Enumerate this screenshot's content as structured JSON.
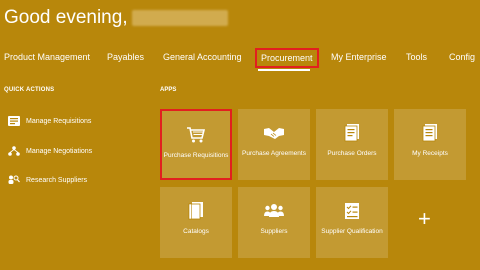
{
  "header": {
    "greeting": "Good evening,"
  },
  "nav": {
    "items": [
      {
        "label": "Product Management"
      },
      {
        "label": "Payables"
      },
      {
        "label": "General Accounting"
      },
      {
        "label": "Procurement",
        "active": true
      },
      {
        "label": "My Enterprise"
      },
      {
        "label": "Tools"
      },
      {
        "label": "Config"
      }
    ]
  },
  "quick_actions": {
    "title": "QUICK ACTIONS",
    "items": [
      {
        "label": "Manage Requisitions",
        "icon": "list-icon"
      },
      {
        "label": "Manage Negotiations",
        "icon": "org-chart-icon"
      },
      {
        "label": "Research Suppliers",
        "icon": "people-search-icon"
      }
    ]
  },
  "apps": {
    "title": "APPS",
    "tiles": [
      {
        "label": "Purchase Requisitions",
        "icon": "cart-icon"
      },
      {
        "label": "Purchase Agreements",
        "icon": "handshake-icon"
      },
      {
        "label": "Purchase Orders",
        "icon": "document-icon"
      },
      {
        "label": "My Receipts",
        "icon": "receipt-icon"
      },
      {
        "label": "Catalogs",
        "icon": "catalog-icon"
      },
      {
        "label": "Suppliers",
        "icon": "suppliers-icon"
      },
      {
        "label": "Supplier Qualification",
        "icon": "checklist-icon"
      }
    ],
    "add_label": "+"
  },
  "colors": {
    "background": "#b8870b",
    "highlight": "#e21f1f"
  }
}
